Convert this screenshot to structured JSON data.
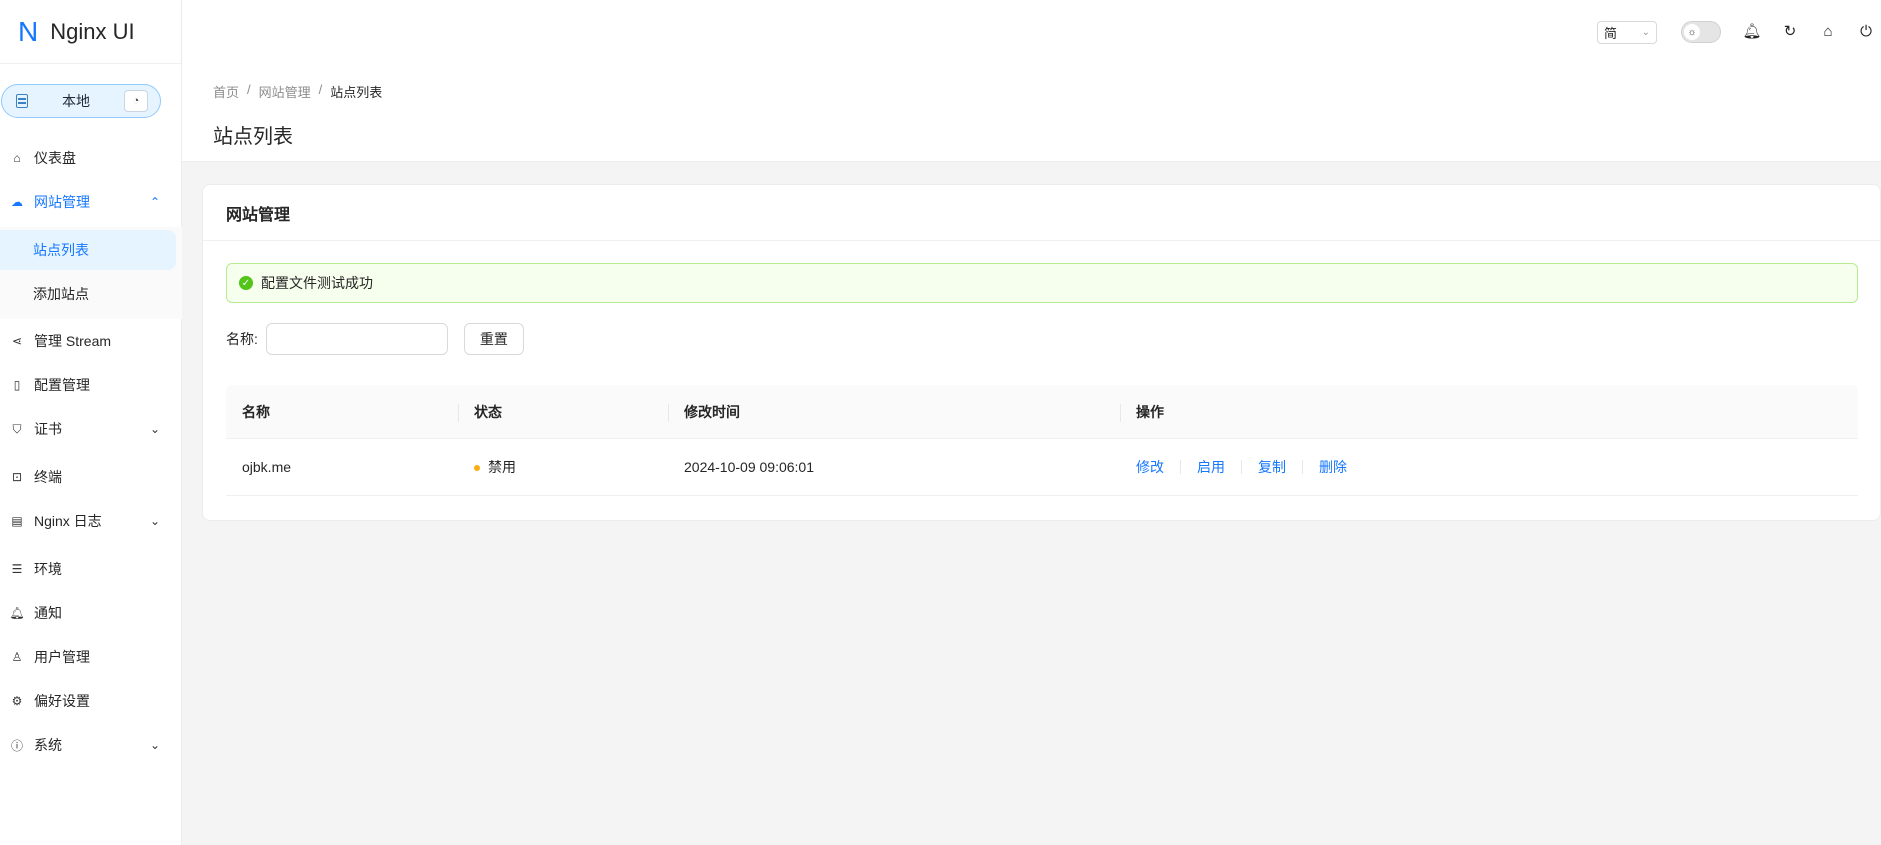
{
  "app": {
    "logo_mark": "N",
    "title": "Nginx UI"
  },
  "env": {
    "label": "本地"
  },
  "sidebar": {
    "items": [
      {
        "label": "仪表盘"
      },
      {
        "label": "网站管理"
      },
      {
        "label": "管理 Stream"
      },
      {
        "label": "配置管理"
      },
      {
        "label": "证书"
      },
      {
        "label": "终端"
      },
      {
        "label": "Nginx 日志"
      },
      {
        "label": "环境"
      },
      {
        "label": "通知"
      },
      {
        "label": "用户管理"
      },
      {
        "label": "偏好设置"
      },
      {
        "label": "系统"
      }
    ],
    "submenu": [
      {
        "label": "站点列表",
        "selected": true
      },
      {
        "label": "添加站点",
        "selected": false
      }
    ]
  },
  "header": {
    "language": "简"
  },
  "breadcrumb": {
    "home": "首页",
    "section": "网站管理",
    "current": "站点列表",
    "sep": "/"
  },
  "page": {
    "title": "站点列表"
  },
  "card": {
    "title": "网站管理",
    "alert": "配置文件测试成功",
    "search": {
      "label": "名称:",
      "value": "",
      "placeholder": ""
    },
    "reset_label": "重置"
  },
  "table": {
    "columns": [
      "名称",
      "状态",
      "修改时间",
      "操作"
    ],
    "rows": [
      {
        "name": "ojbk.me",
        "status": "禁用",
        "modified": "2024-10-09 09:06:01",
        "actions": [
          "修改",
          "启用",
          "复制",
          "删除"
        ]
      }
    ]
  },
  "colors": {
    "accent": "#1677ff",
    "success": "#52c41a",
    "warning": "#faad14"
  }
}
